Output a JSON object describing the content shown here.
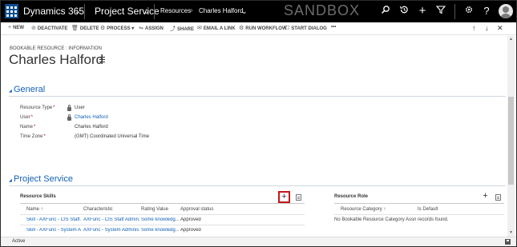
{
  "nav": {
    "app_name": "Dynamics 365",
    "area": "Project Service",
    "breadcrumbs": [
      "Resources",
      "Charles Halford"
    ],
    "environment": "SANDBOX",
    "icons": [
      "search-icon",
      "recent-icon",
      "create-icon",
      "advanced-find-icon",
      "settings-icon",
      "help-icon",
      "avatar"
    ]
  },
  "commands": [
    {
      "icon": "+",
      "label": "NEW"
    },
    {
      "icon": "⊘",
      "label": "DEACTIVATE"
    },
    {
      "icon": "🗑",
      "label": "DELETE"
    },
    {
      "icon": "⚙",
      "label": "PROCESS ▾"
    },
    {
      "icon": "⇋",
      "label": "ASSIGN"
    },
    {
      "icon": "⤴",
      "label": "SHARE"
    },
    {
      "icon": "✉",
      "label": "EMAIL A LINK"
    },
    {
      "icon": "⚙",
      "label": "RUN WORKFLOW"
    },
    {
      "icon": "☐",
      "label": "START DIALOG"
    },
    {
      "icon": "",
      "label": "•••"
    }
  ],
  "record_nav": {
    "up": "↑",
    "down": "↓",
    "close": "✕"
  },
  "header": {
    "entity_form": "BOOKABLE RESOURCE : INFORMATION",
    "title": "Charles Halford"
  },
  "general": {
    "heading": "General",
    "fields": [
      {
        "label": "Resource Type",
        "value": "User",
        "locked": true,
        "link": false
      },
      {
        "label": "User",
        "value": "Charles Halford",
        "locked": true,
        "link": true
      },
      {
        "label": "Name",
        "value": "Charles Halford",
        "locked": false,
        "link": false
      },
      {
        "label": "Time Zone",
        "value": "(GMT) Coordinated Universal Time",
        "locked": false,
        "link": false
      }
    ]
  },
  "project_service": {
    "heading": "Project Service",
    "skills_grid": {
      "title": "Resource Skills",
      "add": "+",
      "columns": [
        "Name ↑",
        "Characteristic",
        "Rating Value",
        "Approval status"
      ],
      "rows": [
        [
          "Skill - AXFunc - CIS Staff...",
          "AXFunc - CIS Staff Admin...",
          "Some knowledg...",
          "Approved"
        ],
        [
          "Skill - AXFunc - System A...",
          "AXFunc - System Adminis...",
          "Some knowledg...",
          "Approved"
        ]
      ]
    },
    "role_grid": {
      "title": "Resource Role",
      "add": "+",
      "columns": [
        "Resource Category ↑",
        "Is Default"
      ],
      "empty_message": "No Bookable Resource Category Assn records found."
    }
  },
  "footer": {
    "status": "Active"
  },
  "colors": {
    "nav_bg": "#000000",
    "accent": "#1160b7",
    "highlight": "#c4161c"
  }
}
